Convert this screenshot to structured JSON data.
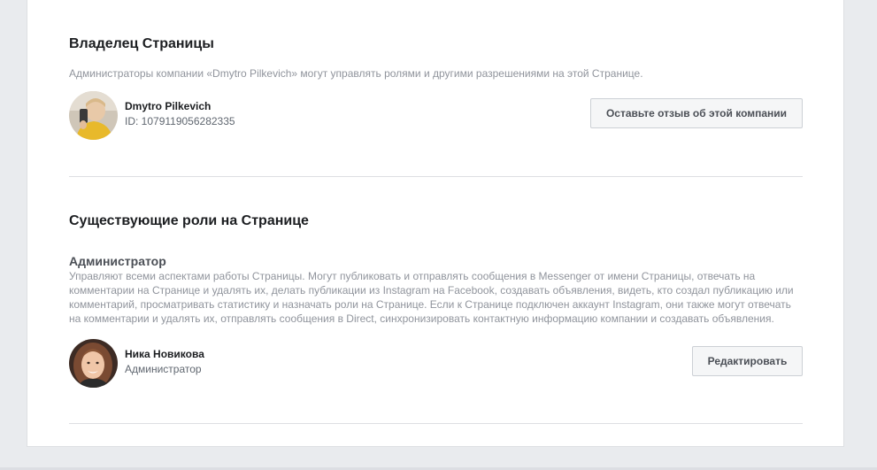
{
  "owner": {
    "title": "Владелец Страницы",
    "description": "Администраторы компании «Dmytro Pilkevich» могут управлять ролями и другими разрешениями на этой Странице.",
    "name": "Dmytro Pilkevich",
    "id_text": "ID: 1079119056282335",
    "feedback_button": "Оставьте отзыв об этой компании"
  },
  "roles": {
    "title": "Существующие роли на Странице",
    "role_name": "Администратор",
    "role_description": "Управляют всеми аспектами работы Страницы. Могут публиковать и отправлять сообщения в Messenger от имени Страницы, отвечать на комментарии на Странице и удалять их, делать публикации из Instagram на Facebook, создавать объявления, видеть, кто создал публикацию или комментарий, просматривать статистику и назначать роли на Странице. Если к Странице подключен аккаунт Instagram, они также могут отвечать на комментарии и удалять их, отправлять сообщения в Direct, синхронизировать контактную информацию компании и создавать объявления.",
    "member": {
      "name": "Ника Новикова",
      "role": "Администратор",
      "edit_button": "Редактировать"
    }
  },
  "colors": {
    "background": "#e9ebee",
    "card": "#ffffff",
    "muted_text": "#90949c",
    "button_bg": "#f5f6f7"
  }
}
